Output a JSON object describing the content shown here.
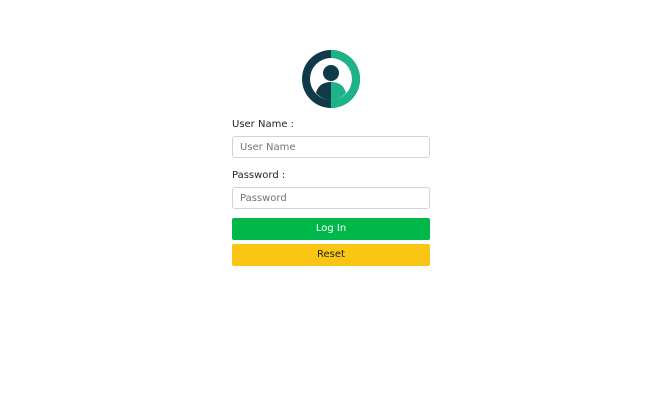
{
  "avatar": {
    "icon": "user-avatar-icon",
    "colors": {
      "ring_dark": "#0f3a4a",
      "ring_accent": "#1cb38a",
      "figure": "#0f3a4a"
    }
  },
  "form": {
    "username": {
      "label": "User Name :",
      "placeholder": "User Name",
      "value": ""
    },
    "password": {
      "label": "Password :",
      "placeholder": "Password",
      "value": ""
    },
    "login_label": "Log In",
    "reset_label": "Reset"
  },
  "colors": {
    "login_button": "#00b74a",
    "reset_button": "#fbc613"
  }
}
